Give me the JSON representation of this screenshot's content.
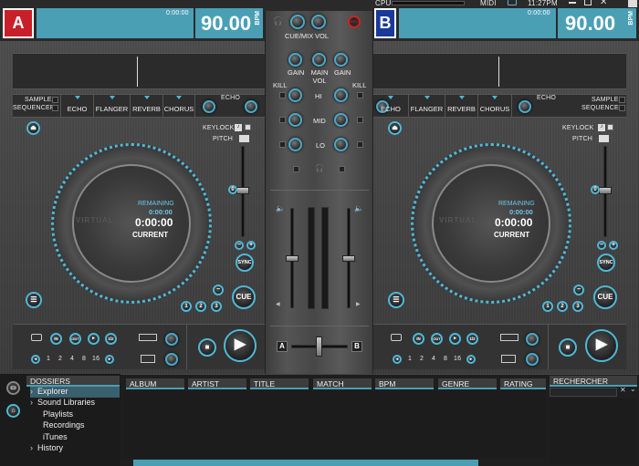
{
  "app": {
    "system": {
      "cpu_label": "CPU",
      "midi_label": "MIDI",
      "clock": "11:27PM"
    },
    "colors": {
      "accent": "#4a9fb5",
      "deck_a": "#c8202a",
      "deck_b": "#1a3a9a"
    }
  },
  "deck_a": {
    "badge": "A",
    "time": "0:00:00",
    "bpm": "90.00",
    "bpm_unit": "BPM",
    "sampler": "SAMPLER",
    "sequencer": "SEQUENCER",
    "fx": [
      "ECHO",
      "FLANGER",
      "REVERB",
      "CHORUS"
    ],
    "echo": "ECHO",
    "keylock": "KEYLOCK",
    "pitch": "PITCH",
    "remaining": "REMAINING",
    "rem_time": "0:00:00",
    "time_big": "0:00:00",
    "current": "CURRENT",
    "brand": "VIRTUAL",
    "sync": "SYNC",
    "cue": "CUE",
    "hotcues": [
      "1",
      "2",
      "3"
    ],
    "loop_in": "IN",
    "loop_out": "OUT",
    "loop_half": "1/2",
    "loop_sizes": [
      "1",
      "2",
      "4",
      "8",
      "16"
    ]
  },
  "deck_b": {
    "badge": "B",
    "time": "0:00:00",
    "bpm": "90.00",
    "bpm_unit": "BPM",
    "sampler": "SAMPLER",
    "sequencer": "SEQUENCER",
    "fx": [
      "ECHO",
      "FLANGER",
      "REVERB",
      "CHORUS"
    ],
    "echo": "ECHO",
    "keylock": "KEYLOCK",
    "pitch": "PITCH",
    "remaining": "REMAINING",
    "rem_time": "0:00:00",
    "time_big": "0:00:00",
    "current": "CURRENT",
    "brand": "VIRTUAL",
    "sync": "SYNC",
    "cue": "CUE",
    "hotcues": [
      "1",
      "2",
      "3"
    ],
    "loop_in": "IN",
    "loop_out": "OUT",
    "loop_half": "1/2",
    "loop_sizes": [
      "1",
      "2",
      "4",
      "8",
      "16"
    ]
  },
  "mixer": {
    "rec": "REC",
    "cue_mix": "CUE/MIX",
    "vol": "VOL",
    "gain": "GAIN",
    "main_vol": "MAIN VOL",
    "kill": "KILL",
    "hi": "HI",
    "mid": "MID",
    "lo": "LO",
    "xf_a": "A",
    "xf_b": "B"
  },
  "browser": {
    "folders_title": "DOSSIERS",
    "tree": [
      "Explorer",
      "Sound Libraries",
      "Playlists",
      "Recordings",
      "iTunes",
      "History"
    ],
    "columns": [
      "ALBUM",
      "ARTIST",
      "TITLE",
      "MATCH",
      "BPM",
      "GENRE",
      "RATING"
    ],
    "search_title": "RECHERCHER"
  }
}
